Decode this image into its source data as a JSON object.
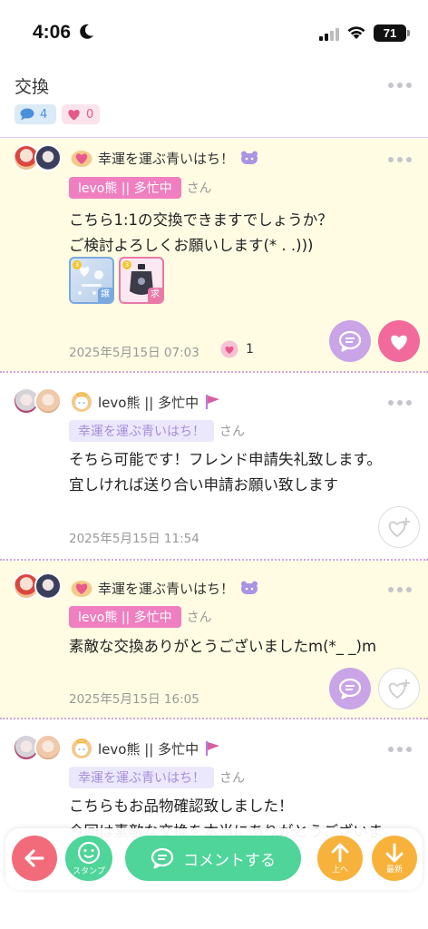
{
  "status": {
    "time": "4:06",
    "battery": "71"
  },
  "header": {
    "title": "交換",
    "comment_count": "4",
    "like_count": "0"
  },
  "comments": [
    {
      "name": "幸運を運ぶ青いはち！",
      "reply_to": "levo熊 || 多忙中",
      "san": "さん",
      "text": "こちら1:1の交換できますでしょうか？\nご検討よろしくお願いします(* . .)))",
      "items": [
        {
          "number": "3",
          "badge": "譲"
        },
        {
          "number": "3",
          "badge": "求"
        }
      ],
      "date": "2025年5月15日 07:03",
      "likes": "1"
    },
    {
      "name": "levo熊 || 多忙中",
      "reply_to": "幸運を運ぶ青いはち！",
      "san": "さん",
      "text": "そちら可能です！フレンド申請失礼致します。\n宜しければ送り合い申請お願い致します",
      "date": "2025年5月15日 11:54"
    },
    {
      "name": "幸運を運ぶ青いはち！",
      "reply_to": "levo熊 || 多忙中",
      "san": "さん",
      "text": "素敵な交換ありがとうございましたm(*_ _)m",
      "date": "2025年5月15日 16:05"
    },
    {
      "name": "levo熊 || 多忙中",
      "reply_to": "幸運を運ぶ青いはち！",
      "san": "さん",
      "text": "こちらもお品物確認致しました！\n今回は素敵な交換を本当にありがとうございま"
    }
  ],
  "bottom_bar": {
    "stamp_label": "スタンプ",
    "comment_label": "コメントする",
    "up_label": "上へ",
    "latest_label": "最新"
  },
  "colors": {
    "yellow_bg": "#fffce3",
    "pink_tag": "#ef7fc0",
    "lavender_tag": "#ebe8fb",
    "green": "#4fd49a",
    "orange": "#f7b23b",
    "red": "#f26b7a"
  }
}
